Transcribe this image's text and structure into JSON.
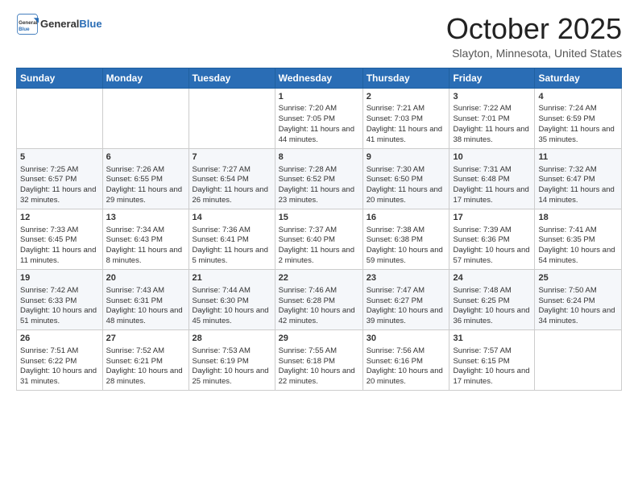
{
  "header": {
    "logo_general": "General",
    "logo_blue": "Blue",
    "month": "October 2025",
    "location": "Slayton, Minnesota, United States"
  },
  "days_of_week": [
    "Sunday",
    "Monday",
    "Tuesday",
    "Wednesday",
    "Thursday",
    "Friday",
    "Saturday"
  ],
  "weeks": [
    [
      {
        "day": "",
        "sunrise": "",
        "sunset": "",
        "daylight": ""
      },
      {
        "day": "",
        "sunrise": "",
        "sunset": "",
        "daylight": ""
      },
      {
        "day": "",
        "sunrise": "",
        "sunset": "",
        "daylight": ""
      },
      {
        "day": "1",
        "sunrise": "Sunrise: 7:20 AM",
        "sunset": "Sunset: 7:05 PM",
        "daylight": "Daylight: 11 hours and 44 minutes."
      },
      {
        "day": "2",
        "sunrise": "Sunrise: 7:21 AM",
        "sunset": "Sunset: 7:03 PM",
        "daylight": "Daylight: 11 hours and 41 minutes."
      },
      {
        "day": "3",
        "sunrise": "Sunrise: 7:22 AM",
        "sunset": "Sunset: 7:01 PM",
        "daylight": "Daylight: 11 hours and 38 minutes."
      },
      {
        "day": "4",
        "sunrise": "Sunrise: 7:24 AM",
        "sunset": "Sunset: 6:59 PM",
        "daylight": "Daylight: 11 hours and 35 minutes."
      }
    ],
    [
      {
        "day": "5",
        "sunrise": "Sunrise: 7:25 AM",
        "sunset": "Sunset: 6:57 PM",
        "daylight": "Daylight: 11 hours and 32 minutes."
      },
      {
        "day": "6",
        "sunrise": "Sunrise: 7:26 AM",
        "sunset": "Sunset: 6:55 PM",
        "daylight": "Daylight: 11 hours and 29 minutes."
      },
      {
        "day": "7",
        "sunrise": "Sunrise: 7:27 AM",
        "sunset": "Sunset: 6:54 PM",
        "daylight": "Daylight: 11 hours and 26 minutes."
      },
      {
        "day": "8",
        "sunrise": "Sunrise: 7:28 AM",
        "sunset": "Sunset: 6:52 PM",
        "daylight": "Daylight: 11 hours and 23 minutes."
      },
      {
        "day": "9",
        "sunrise": "Sunrise: 7:30 AM",
        "sunset": "Sunset: 6:50 PM",
        "daylight": "Daylight: 11 hours and 20 minutes."
      },
      {
        "day": "10",
        "sunrise": "Sunrise: 7:31 AM",
        "sunset": "Sunset: 6:48 PM",
        "daylight": "Daylight: 11 hours and 17 minutes."
      },
      {
        "day": "11",
        "sunrise": "Sunrise: 7:32 AM",
        "sunset": "Sunset: 6:47 PM",
        "daylight": "Daylight: 11 hours and 14 minutes."
      }
    ],
    [
      {
        "day": "12",
        "sunrise": "Sunrise: 7:33 AM",
        "sunset": "Sunset: 6:45 PM",
        "daylight": "Daylight: 11 hours and 11 minutes."
      },
      {
        "day": "13",
        "sunrise": "Sunrise: 7:34 AM",
        "sunset": "Sunset: 6:43 PM",
        "daylight": "Daylight: 11 hours and 8 minutes."
      },
      {
        "day": "14",
        "sunrise": "Sunrise: 7:36 AM",
        "sunset": "Sunset: 6:41 PM",
        "daylight": "Daylight: 11 hours and 5 minutes."
      },
      {
        "day": "15",
        "sunrise": "Sunrise: 7:37 AM",
        "sunset": "Sunset: 6:40 PM",
        "daylight": "Daylight: 11 hours and 2 minutes."
      },
      {
        "day": "16",
        "sunrise": "Sunrise: 7:38 AM",
        "sunset": "Sunset: 6:38 PM",
        "daylight": "Daylight: 10 hours and 59 minutes."
      },
      {
        "day": "17",
        "sunrise": "Sunrise: 7:39 AM",
        "sunset": "Sunset: 6:36 PM",
        "daylight": "Daylight: 10 hours and 57 minutes."
      },
      {
        "day": "18",
        "sunrise": "Sunrise: 7:41 AM",
        "sunset": "Sunset: 6:35 PM",
        "daylight": "Daylight: 10 hours and 54 minutes."
      }
    ],
    [
      {
        "day": "19",
        "sunrise": "Sunrise: 7:42 AM",
        "sunset": "Sunset: 6:33 PM",
        "daylight": "Daylight: 10 hours and 51 minutes."
      },
      {
        "day": "20",
        "sunrise": "Sunrise: 7:43 AM",
        "sunset": "Sunset: 6:31 PM",
        "daylight": "Daylight: 10 hours and 48 minutes."
      },
      {
        "day": "21",
        "sunrise": "Sunrise: 7:44 AM",
        "sunset": "Sunset: 6:30 PM",
        "daylight": "Daylight: 10 hours and 45 minutes."
      },
      {
        "day": "22",
        "sunrise": "Sunrise: 7:46 AM",
        "sunset": "Sunset: 6:28 PM",
        "daylight": "Daylight: 10 hours and 42 minutes."
      },
      {
        "day": "23",
        "sunrise": "Sunrise: 7:47 AM",
        "sunset": "Sunset: 6:27 PM",
        "daylight": "Daylight: 10 hours and 39 minutes."
      },
      {
        "day": "24",
        "sunrise": "Sunrise: 7:48 AM",
        "sunset": "Sunset: 6:25 PM",
        "daylight": "Daylight: 10 hours and 36 minutes."
      },
      {
        "day": "25",
        "sunrise": "Sunrise: 7:50 AM",
        "sunset": "Sunset: 6:24 PM",
        "daylight": "Daylight: 10 hours and 34 minutes."
      }
    ],
    [
      {
        "day": "26",
        "sunrise": "Sunrise: 7:51 AM",
        "sunset": "Sunset: 6:22 PM",
        "daylight": "Daylight: 10 hours and 31 minutes."
      },
      {
        "day": "27",
        "sunrise": "Sunrise: 7:52 AM",
        "sunset": "Sunset: 6:21 PM",
        "daylight": "Daylight: 10 hours and 28 minutes."
      },
      {
        "day": "28",
        "sunrise": "Sunrise: 7:53 AM",
        "sunset": "Sunset: 6:19 PM",
        "daylight": "Daylight: 10 hours and 25 minutes."
      },
      {
        "day": "29",
        "sunrise": "Sunrise: 7:55 AM",
        "sunset": "Sunset: 6:18 PM",
        "daylight": "Daylight: 10 hours and 22 minutes."
      },
      {
        "day": "30",
        "sunrise": "Sunrise: 7:56 AM",
        "sunset": "Sunset: 6:16 PM",
        "daylight": "Daylight: 10 hours and 20 minutes."
      },
      {
        "day": "31",
        "sunrise": "Sunrise: 7:57 AM",
        "sunset": "Sunset: 6:15 PM",
        "daylight": "Daylight: 10 hours and 17 minutes."
      },
      {
        "day": "",
        "sunrise": "",
        "sunset": "",
        "daylight": ""
      }
    ]
  ]
}
